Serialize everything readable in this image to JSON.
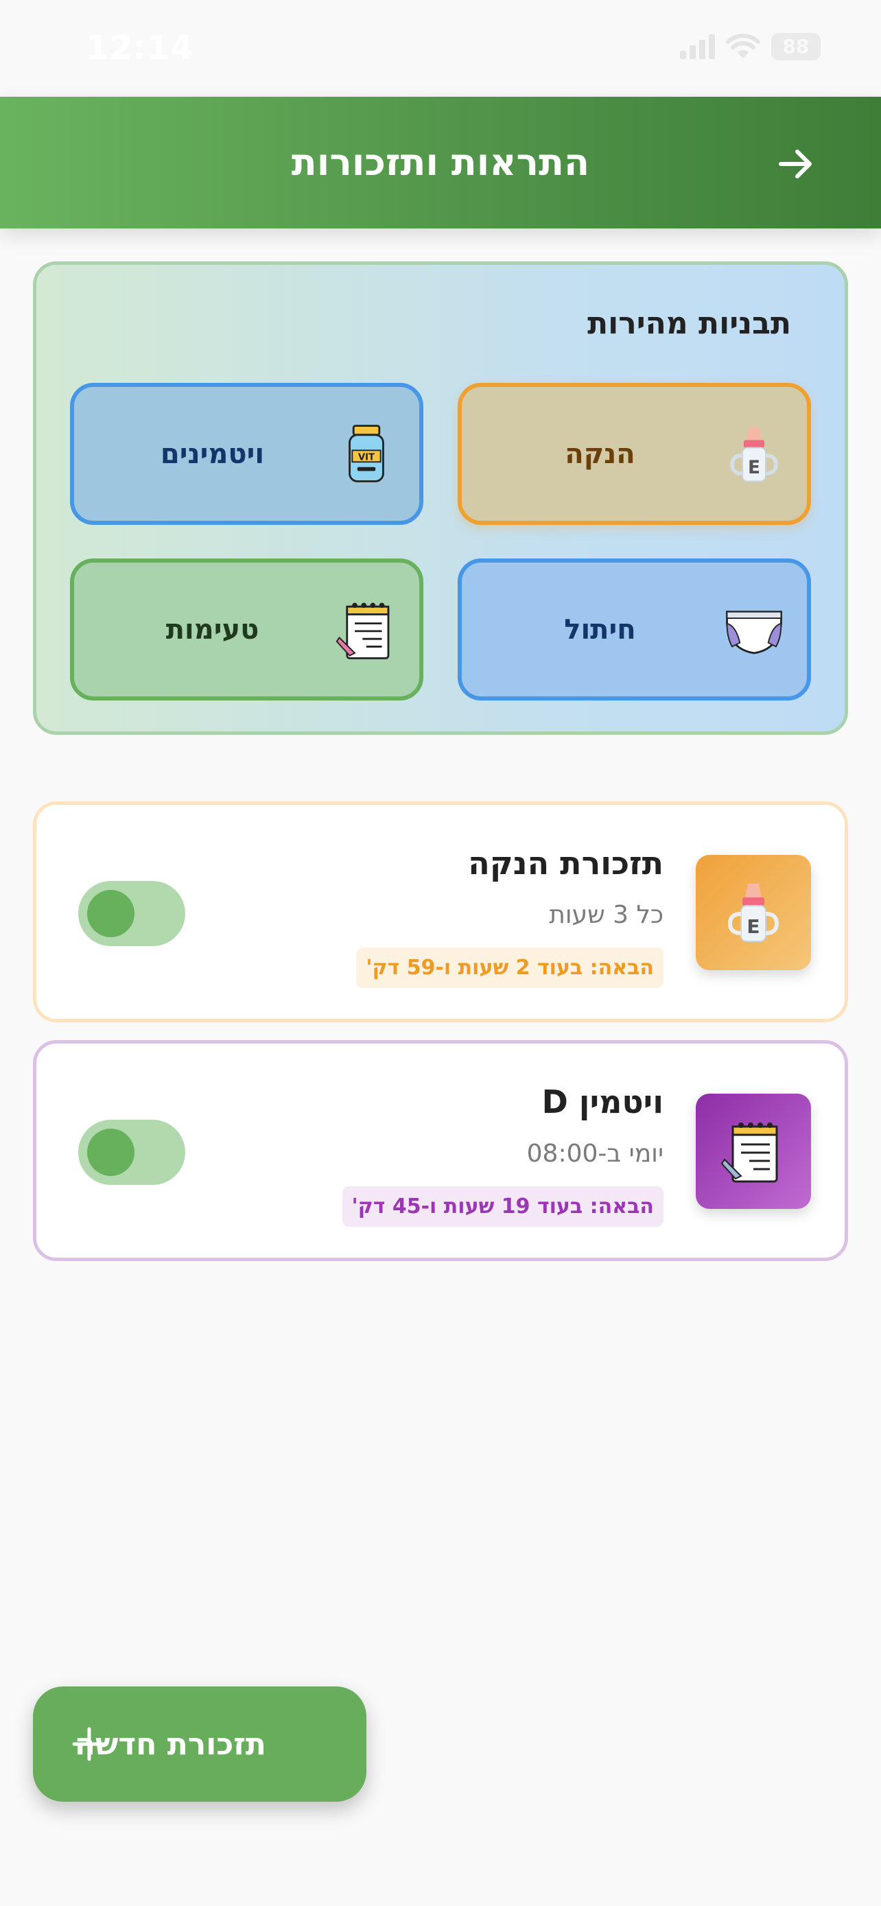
{
  "status_bar": {
    "time": "12:14",
    "battery": "88"
  },
  "header": {
    "title": "התראות ותזכורות"
  },
  "templates": {
    "title": "תבניות מהירות",
    "items": [
      {
        "label": "הנקה",
        "icon": "baby-bottle-icon",
        "color": "#f0a030"
      },
      {
        "label": "ויטמינים",
        "icon": "vitamin-jar-icon",
        "color": "#4896e8"
      },
      {
        "label": "חיתול",
        "icon": "diaper-icon",
        "color": "#4896e8"
      },
      {
        "label": "טעימות",
        "icon": "notepad-icon",
        "color": "#67b05c"
      }
    ]
  },
  "reminders": [
    {
      "title": "תזכורת הנקה",
      "subtitle": "כל 3 שעות",
      "next": "הבאה: בעוד 2 שעות ו-59 דק'",
      "icon": "baby-bottle-icon",
      "enabled": true,
      "accent": "#ef9a22"
    },
    {
      "title": "ויטמין D",
      "subtitle": "יומי ב-08:00",
      "next": "הבאה: בעוד 19 שעות ו-45 דק'",
      "icon": "notepad-icon",
      "enabled": true,
      "accent": "#9b36b4"
    }
  ],
  "fab": {
    "label": "תזכורת חדשה",
    "icon": "plus-icon"
  },
  "colors": {
    "primary": "#67ad5b",
    "header_dark": "#3f7e38"
  }
}
